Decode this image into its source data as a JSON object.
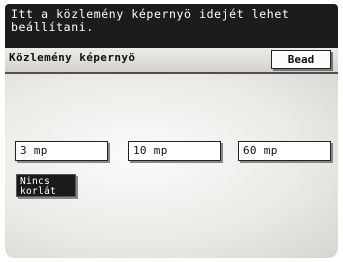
{
  "message": {
    "line1": "Itt a közlemény képernyö idejét lehet",
    "line2": "beállítani."
  },
  "header": {
    "title": "Közlemény képernyö",
    "close_label": "Bead"
  },
  "options": [
    {
      "label": "3 mp"
    },
    {
      "label": "10 mp"
    },
    {
      "label": "60 mp"
    }
  ],
  "no_limit": {
    "line1": "Nincs",
    "line2": "korlát",
    "selected": true
  },
  "colors": {
    "message_bar": "#1c1c1c",
    "selected_button": "#1a1a1a",
    "background": "#ffffff"
  }
}
